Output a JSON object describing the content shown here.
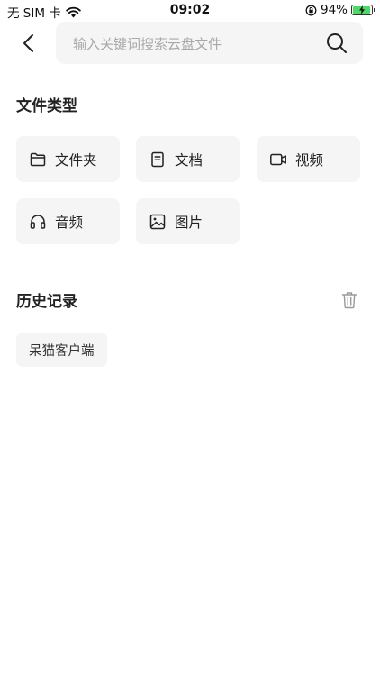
{
  "status_bar": {
    "carrier": "无 SIM 卡",
    "time": "09:02",
    "battery_percent": "94%",
    "battery_level": 0.94,
    "icons": [
      "wifi-icon",
      "orientation-lock-icon",
      "battery-charging-icon"
    ]
  },
  "header": {
    "back_icon": "chevron-left-icon",
    "search_placeholder": "输入关键词搜索云盘文件",
    "search_value": "",
    "search_icon": "search-icon"
  },
  "file_types": {
    "title": "文件类型",
    "items": [
      {
        "label": "文件夹",
        "icon": "folder-icon"
      },
      {
        "label": "文档",
        "icon": "document-icon"
      },
      {
        "label": "视频",
        "icon": "video-icon"
      },
      {
        "label": "音频",
        "icon": "headphones-icon"
      },
      {
        "label": "图片",
        "icon": "image-icon"
      }
    ]
  },
  "history": {
    "title": "历史记录",
    "clear_icon": "trash-icon",
    "items": [
      "呆猫客户端"
    ]
  },
  "colors": {
    "background": "#ffffff",
    "tile_background": "#f5f5f5",
    "text": "#222222",
    "placeholder": "#a8a8a8",
    "battery_fill": "#4cd964"
  }
}
